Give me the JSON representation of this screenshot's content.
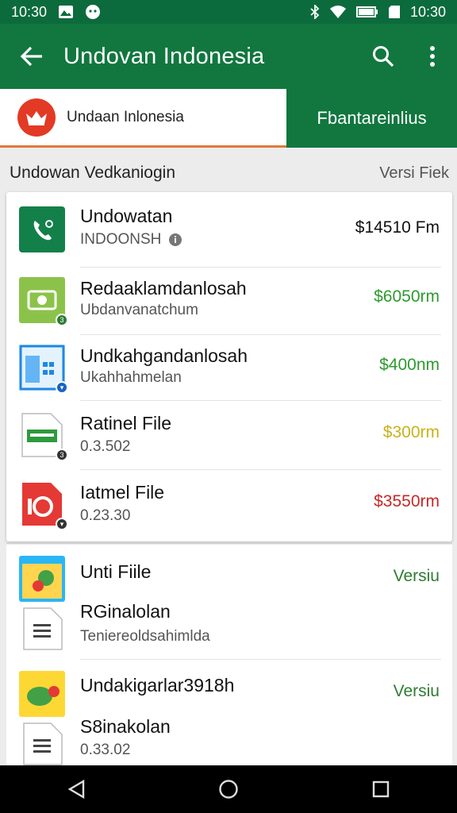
{
  "status_bar": {
    "time_left": "10:30",
    "time_right": "10:30"
  },
  "app_bar": {
    "title": "Undovan Indonesia"
  },
  "tabs": {
    "left_label": "Undaan Inlonesia",
    "right_label": "Fbantareinlius"
  },
  "section": {
    "title": "Undowan Vedkaniogin",
    "right_label": "Versi Fiek"
  },
  "items": [
    {
      "name": "Undowatan",
      "sub": "INDOONSH",
      "price": "$14510 Fm",
      "price_color": "#111111"
    },
    {
      "name": "Redaaklamdanlosah",
      "sub": "Ubdanvanatchum",
      "price": "$6050rm",
      "price_color": "#2e9a2e"
    },
    {
      "name": "Undkahgandanlosah",
      "sub": "Ukahhahmelan",
      "price": "$400nm",
      "price_color": "#2e9a2e"
    },
    {
      "name": "Ratinel File",
      "sub": "0.3.502",
      "price": "$300rm",
      "price_color": "#c9b21a"
    },
    {
      "name": "Iatmel File",
      "sub": "0.23.30",
      "price": "$3550rm",
      "price_color": "#c62828"
    }
  ],
  "items2": [
    {
      "name": "Unti Fiile",
      "right": "Versiu",
      "name2": "RGinalolan",
      "sub2": "Teniereoldsahimlda"
    },
    {
      "name": "Undakigarlar3918h",
      "right": "Versiu",
      "name2": "S8inakolan",
      "sub2": "0.33.02"
    }
  ],
  "colors": {
    "primary": "#11773f",
    "status": "#0c6b3c",
    "accent": "#e07a3c"
  }
}
